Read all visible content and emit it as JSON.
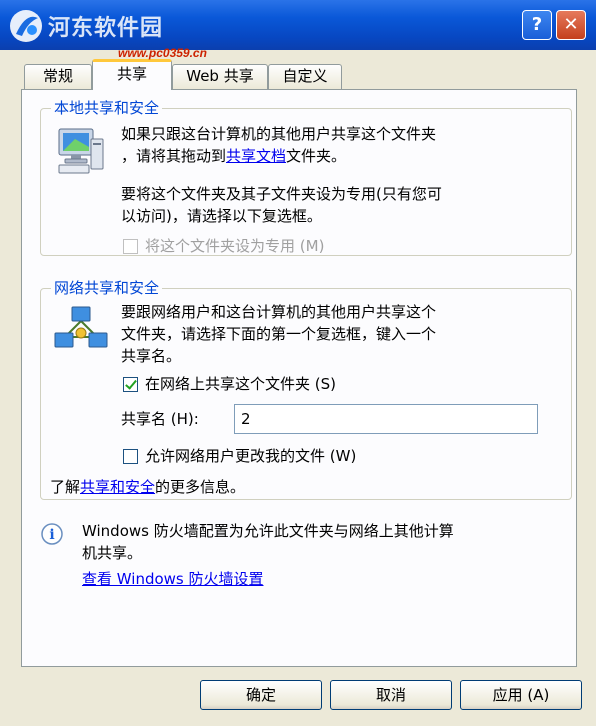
{
  "window": {
    "watermark": "河东软件园",
    "watermark_url": "www.pc0359.cn",
    "help_label": "?",
    "close_label": "✕"
  },
  "tabs": [
    {
      "label": "常规",
      "active": false
    },
    {
      "label": "共享",
      "active": true
    },
    {
      "label": "Web 共享",
      "active": false
    },
    {
      "label": "自定义",
      "active": false
    }
  ],
  "local": {
    "legend": "本地共享和安全",
    "line1": "如果只跟这台计算机的其他用户共享这个文件夹",
    "line2_pre": "，请将其拖动到",
    "line2_link": "共享文档",
    "line2_post": "文件夹。",
    "line3": "要将这个文件夹及其子文件夹设为专用(只有您可",
    "line4": "以访问)，请选择以下复选框。",
    "private_checkbox_label": "将这个文件夹设为专用 (M)"
  },
  "network": {
    "legend": "网络共享和安全",
    "line1": "要跟网络用户和这台计算机的其他用户共享这个",
    "line2": "文件夹，请选择下面的第一个复选框，键入一个",
    "line3": "共享名。",
    "share_checkbox_label": "在网络上共享这个文件夹 (S)",
    "share_checked": true,
    "share_name_label": "共享名 (H):",
    "share_name_value": "2",
    "allow_change_label": "允许网络用户更改我的文件 (W)",
    "allow_change_checked": false
  },
  "learn": {
    "pre": "了解",
    "link": "共享和安全",
    "post": "的更多信息。"
  },
  "firewall": {
    "info_glyph": "i",
    "line1": "Windows 防火墙配置为允许此文件夹与网络上其他计算",
    "line2": "机共享。",
    "link": "查看 Windows 防火墙设置"
  },
  "buttons": {
    "ok": "确定",
    "cancel": "取消",
    "apply": "应用 (A)"
  }
}
